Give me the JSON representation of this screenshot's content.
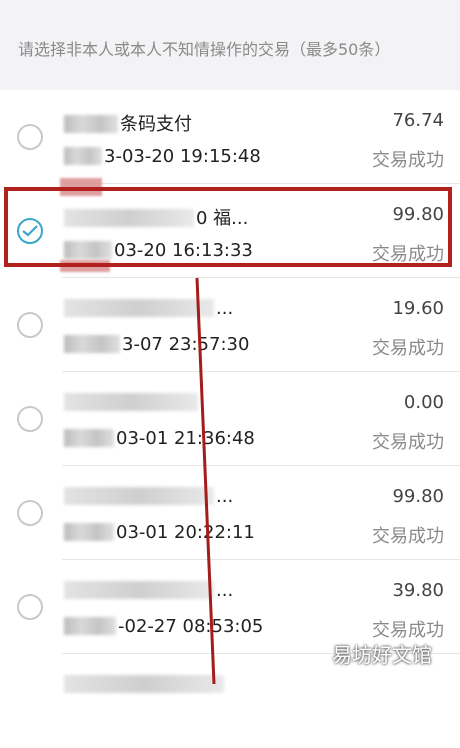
{
  "header": {
    "text": "请选择非本人或本人不知情操作的交易（最多50条）"
  },
  "transactions": [
    {
      "name": "条码支付",
      "time": "3-03-20 19:15:48",
      "amount": "76.74",
      "status": "交易成功",
      "checked": false
    },
    {
      "name": "0 福...",
      "time": "03-20 16:13:33",
      "amount": "99.80",
      "status": "交易成功",
      "checked": true
    },
    {
      "name": "...",
      "time": "3-07 23:57:30",
      "amount": "19.60",
      "status": "交易成功",
      "checked": false
    },
    {
      "name": "",
      "time": "03-01 21:36:48",
      "amount": "0.00",
      "status": "交易成功",
      "checked": false
    },
    {
      "name": "...",
      "time": "03-01 20:22:11",
      "amount": "99.80",
      "status": "交易成功",
      "checked": false
    },
    {
      "name": "...",
      "time": "-02-27 08:53:05",
      "amount": "39.80",
      "status": "交易成功",
      "checked": false
    }
  ],
  "watermark": "易坊好文馆",
  "colors": {
    "accent": "#3aa6c9",
    "highlight": "#b0201c"
  }
}
